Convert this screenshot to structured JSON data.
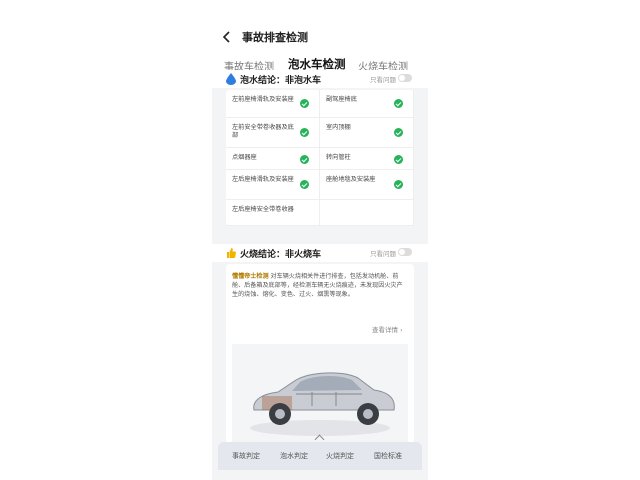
{
  "header": {
    "title": "事故排查检测"
  },
  "tabs": [
    {
      "label": "事故车检测",
      "active": false
    },
    {
      "label": "泡水车检测",
      "active": true
    },
    {
      "label": "火烧车检测",
      "active": false
    }
  ],
  "flood": {
    "verdict": "泡水结论：非泡水车",
    "view_standard_label": "只看问题",
    "items": [
      {
        "label": "左前座椅滑轨及安装座",
        "status": "ok"
      },
      {
        "label": "副驾座椅底",
        "status": "ok"
      },
      {
        "label": "左前安全带卷收器及底部",
        "status": "ok"
      },
      {
        "label": "室内顶棚",
        "status": "ok"
      },
      {
        "label": "点烟器座",
        "status": "ok"
      },
      {
        "label": "转向管柱",
        "status": "ok"
      },
      {
        "label": "左后座椅滑轨及安装座",
        "status": "ok"
      },
      {
        "label": "座舱地毯及安装座",
        "status": "ok"
      },
      {
        "label": "左后座椅安全带卷收器",
        "status": "ok"
      }
    ]
  },
  "fire": {
    "verdict": "火烧结论：非火烧车",
    "view_standard_label": "只看问题",
    "desc_brand": "懂懂帝士检测",
    "desc_text": "对车辆火烧相关件进行排查，包括发动机舱、前舱、后备箱及底部等，经检测车辆无火烧痕迹，未发现因火灾产生的烧蚀、熔化、变色、过火、烟熏等现象。",
    "show_more": "查看详情 ›"
  },
  "bottom_nav": [
    "事故判定",
    "泡水判定",
    "火烧判定",
    "国检标准"
  ],
  "colors": {
    "accent": "#f2b300",
    "check": "#27b35c"
  }
}
